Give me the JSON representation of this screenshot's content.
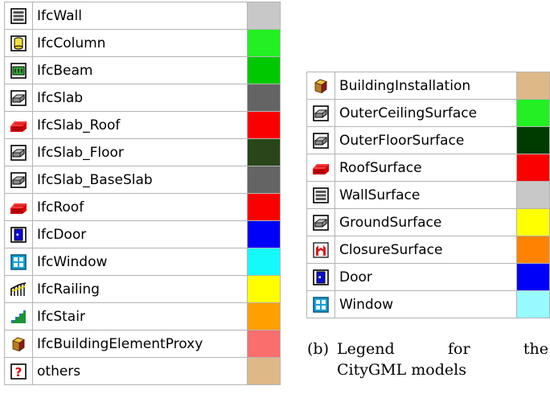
{
  "ifc_legend": {
    "items": [
      {
        "label": "IfcWall",
        "icon": "wall-icon",
        "color": "#c8c8c8"
      },
      {
        "label": "IfcColumn",
        "icon": "column-icon",
        "color": "#22f022"
      },
      {
        "label": "IfcBeam",
        "icon": "beam-icon",
        "color": "#00c800"
      },
      {
        "label": "IfcSlab",
        "icon": "slab-icon",
        "color": "#646464"
      },
      {
        "label": "IfcSlab_Roof",
        "icon": "roof-icon",
        "color": "#fa0000"
      },
      {
        "label": "IfcSlab_Floor",
        "icon": "slab-icon",
        "color": "#284619"
      },
      {
        "label": "IfcSlab_BaseSlab",
        "icon": "slab-icon",
        "color": "#646464"
      },
      {
        "label": "IfcRoof",
        "icon": "roof-icon",
        "color": "#fa0000"
      },
      {
        "label": "IfcDoor",
        "icon": "door-icon",
        "color": "#0000fa"
      },
      {
        "label": "IfcWindow",
        "icon": "window-icon",
        "color": "#14fafa"
      },
      {
        "label": "IfcRailing",
        "icon": "railing-icon",
        "color": "#ffff00"
      },
      {
        "label": "IfcStair",
        "icon": "stair-icon",
        "color": "#ffa000"
      },
      {
        "label": "IfcBuildingElementProxy",
        "icon": "proxy-icon",
        "color": "#fa6e6e"
      },
      {
        "label": "others",
        "icon": "question-icon",
        "color": "#deb887"
      }
    ]
  },
  "citygml_legend": {
    "items": [
      {
        "label": "BuildingInstallation",
        "icon": "proxy-icon",
        "color": "#deb887"
      },
      {
        "label": "OuterCeilingSurface",
        "icon": "slab-icon",
        "color": "#22f022"
      },
      {
        "label": "OuterFloorSurface",
        "icon": "slab-icon",
        "color": "#003c00"
      },
      {
        "label": "RoofSurface",
        "icon": "roof-icon",
        "color": "#fa0000"
      },
      {
        "label": "WallSurface",
        "icon": "wall-icon",
        "color": "#c8c8c8"
      },
      {
        "label": "GroundSurface",
        "icon": "slab-icon",
        "color": "#ffff00"
      },
      {
        "label": "ClosureSurface",
        "icon": "closure-icon",
        "color": "#ff8200"
      },
      {
        "label": "Door",
        "icon": "door-icon",
        "color": "#0000fa"
      },
      {
        "label": "Window",
        "icon": "window-icon",
        "color": "#96faff"
      }
    ]
  },
  "caption": {
    "number": "(b)",
    "line1": "Legend for the",
    "line2": "CityGML models"
  }
}
